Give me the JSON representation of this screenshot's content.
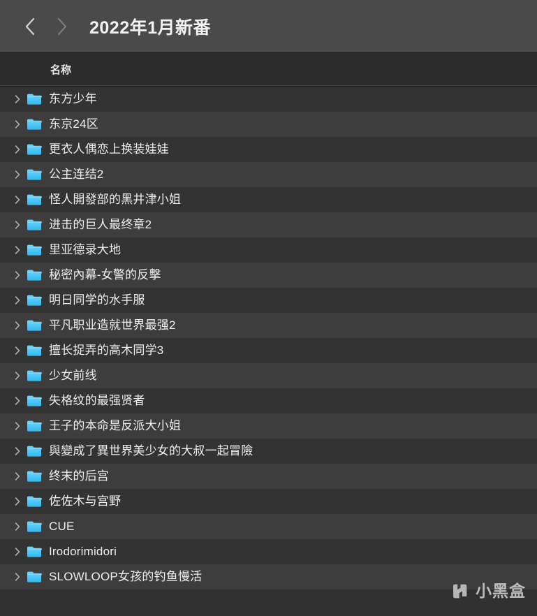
{
  "window": {
    "title": "2022年1月新番",
    "nav": {
      "back_label": "后退",
      "forward_label": "前进"
    }
  },
  "columns": {
    "name_header": "名称"
  },
  "colors": {
    "titlebar_bg": "#4a4a4a",
    "header_bg": "#2c2c2c",
    "row_odd_bg": "#333333",
    "row_even_bg": "#3d3d3d",
    "text": "#efefef",
    "folder_blue": "#35b9f0"
  },
  "watermark": {
    "text": "小黑盒"
  },
  "rows": [
    {
      "name": "东方少年"
    },
    {
      "name": "东京24区"
    },
    {
      "name": "更衣人偶恋上换装娃娃"
    },
    {
      "name": "公主连结2"
    },
    {
      "name": "怪人開發部的黑井津小姐"
    },
    {
      "name": "进击的巨人最终章2"
    },
    {
      "name": "里亚德录大地"
    },
    {
      "name": "秘密內幕-女警的反擊"
    },
    {
      "name": "明日同学的水手服"
    },
    {
      "name": "平凡职业造就世界最强2"
    },
    {
      "name": "擅长捉弄的高木同学3"
    },
    {
      "name": "少女前线"
    },
    {
      "name": "失格纹的最强贤者"
    },
    {
      "name": "王子的本命是反派大小姐"
    },
    {
      "name": "與變成了異世界美少女的大叔一起冒險"
    },
    {
      "name": "终末的后宫"
    },
    {
      "name": "佐佐木与宫野"
    },
    {
      "name": "CUE"
    },
    {
      "name": "Irodorimidori"
    },
    {
      "name": "SLOWLOOP女孩的钓鱼慢活"
    }
  ]
}
